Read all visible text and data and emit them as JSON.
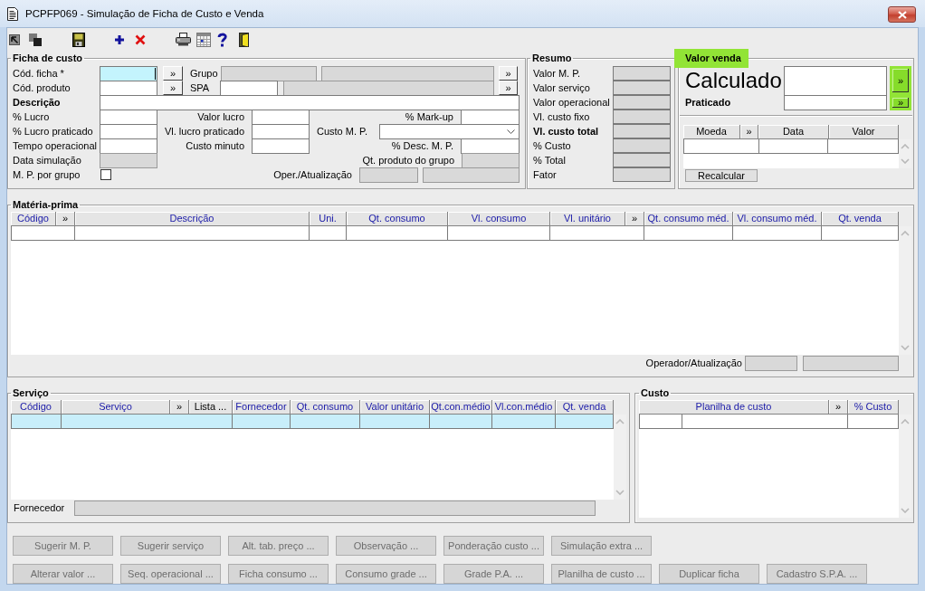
{
  "window": {
    "title": "PCPFP069 - Simulação de Ficha de Custo e Venda"
  },
  "ficha_de_custo": {
    "title": "Ficha de custo",
    "fields": [
      {
        "label": "Cód. ficha *",
        "bold": false,
        "controls": [
          {
            "kind": "field",
            "disabled": false,
            "focused": true
          },
          {
            "kind": "lookup",
            "text": "»"
          }
        ]
      },
      {
        "label": "Grupo",
        "bold": false,
        "controls": [
          {
            "kind": "field",
            "disabled": true,
            "focused": false
          },
          {
            "kind": "field",
            "disabled": true,
            "focused": false
          },
          {
            "kind": "lookup",
            "text": "»"
          }
        ]
      },
      {
        "label": "Cód. produto",
        "bold": false,
        "controls": [
          {
            "kind": "field",
            "disabled": false,
            "focused": false
          },
          {
            "kind": "lookup",
            "text": "»"
          }
        ]
      },
      {
        "label": "SPA",
        "bold": false,
        "controls": [
          {
            "kind": "field",
            "disabled": false,
            "focused": false
          },
          {
            "kind": "field",
            "disabled": true,
            "focused": false
          },
          {
            "kind": "lookup",
            "text": "»"
          }
        ]
      },
      {
        "label": "Descrição",
        "bold": true,
        "controls": [
          {
            "kind": "field",
            "disabled": false,
            "focused": false
          }
        ]
      },
      {
        "label": "% Lucro",
        "bold": false,
        "controls": [
          {
            "kind": "field",
            "disabled": false,
            "focused": false
          }
        ]
      },
      {
        "label": "Valor lucro",
        "bold": false,
        "controls": [
          {
            "kind": "field",
            "disabled": false,
            "focused": false
          }
        ]
      },
      {
        "label": "% Mark-up",
        "bold": false,
        "controls": [
          {
            "kind": "field",
            "disabled": false,
            "focused": false
          }
        ]
      },
      {
        "label": "% Lucro praticado",
        "bold": false,
        "controls": [
          {
            "kind": "field",
            "disabled": false,
            "focused": false
          }
        ]
      },
      {
        "label": "Vl. lucro praticado",
        "bold": false,
        "controls": [
          {
            "kind": "field",
            "disabled": false,
            "focused": false
          }
        ]
      },
      {
        "label": "Custo M. P.",
        "bold": false,
        "controls": [
          {
            "kind": "dropdown"
          }
        ]
      },
      {
        "label": "Tempo operacional",
        "bold": false,
        "controls": [
          {
            "kind": "field",
            "disabled": false,
            "focused": false
          }
        ]
      },
      {
        "label": "Custo minuto",
        "bold": false,
        "controls": [
          {
            "kind": "field",
            "disabled": false,
            "focused": false
          }
        ]
      },
      {
        "label": "% Desc. M. P.",
        "bold": false,
        "controls": [
          {
            "kind": "field",
            "disabled": false,
            "focused": false
          }
        ]
      },
      {
        "label": "Data simulação",
        "bold": false,
        "controls": [
          {
            "kind": "field",
            "disabled": true,
            "focused": false
          }
        ]
      },
      {
        "label": "Qt. produto do grupo",
        "bold": false,
        "controls": [
          {
            "kind": "field",
            "disabled": true,
            "focused": false
          }
        ]
      },
      {
        "label": "M. P. por grupo",
        "bold": false,
        "controls": [
          {
            "kind": "checkbox",
            "checked": false
          }
        ]
      },
      {
        "label": "Oper./Atualização",
        "bold": false,
        "controls": [
          {
            "kind": "field",
            "disabled": true,
            "focused": false
          },
          {
            "kind": "field",
            "disabled": true,
            "focused": false
          }
        ]
      }
    ]
  },
  "resumo": {
    "title": "Resumo",
    "rows": [
      {
        "label": "Valor M. P.",
        "bold": false,
        "disabled": true
      },
      {
        "label": "Valor serviço",
        "bold": false,
        "disabled": true
      },
      {
        "label": "Valor operacional",
        "bold": false,
        "disabled": true
      },
      {
        "label": "Vl. custo fixo",
        "bold": false,
        "disabled": true
      },
      {
        "label": "Vl. custo total",
        "bold": true,
        "disabled": true
      },
      {
        "label": "% Custo",
        "bold": false,
        "disabled": true
      },
      {
        "label": "% Total",
        "bold": false,
        "disabled": true
      },
      {
        "label": "Fator",
        "bold": false,
        "disabled": true
      }
    ]
  },
  "valor_venda": {
    "title": "Valor venda",
    "highlighted": true,
    "fields": [
      {
        "kind": "primary",
        "label": "Calculado",
        "button": {
          "text": "»",
          "highlighted": true
        }
      },
      {
        "kind": "secondary",
        "label": "Praticado",
        "button": {
          "text": "»",
          "highlighted": true
        }
      }
    ],
    "currency_grid": {
      "columns": [
        {
          "label": "Moeda",
          "kind": "plain"
        },
        {
          "label": "»",
          "kind": "plain"
        },
        {
          "label": "Data",
          "kind": "plain"
        },
        {
          "label": "Valor",
          "kind": "plain"
        }
      ],
      "rows": [
        {
          "selected": false
        }
      ]
    },
    "recalculate_button": {
      "label": "Recalcular",
      "disabled": false
    }
  },
  "materia_prima": {
    "title": "Matéria-prima",
    "grid": {
      "columns": [
        {
          "label": "Código",
          "kind": "link"
        },
        {
          "label": "»",
          "kind": "plain"
        },
        {
          "label": "Descrição",
          "kind": "link"
        },
        {
          "label": "Uni.",
          "kind": "link"
        },
        {
          "label": "Qt. consumo",
          "kind": "link"
        },
        {
          "label": "Vl. consumo",
          "kind": "link"
        },
        {
          "label": "Vl. unitário",
          "kind": "link"
        },
        {
          "label": "»",
          "kind": "plain"
        },
        {
          "label": "Qt. consumo méd.",
          "kind": "link"
        },
        {
          "label": "Vl. consumo méd.",
          "kind": "link"
        },
        {
          "label": "Qt. venda",
          "kind": "link"
        }
      ],
      "rows": [
        {
          "selected": false
        }
      ]
    },
    "footer": {
      "label": "Operador/Atualização",
      "fields": [
        {
          "disabled": true
        },
        {
          "disabled": true
        }
      ]
    }
  },
  "servico": {
    "title": "Serviço",
    "grid": {
      "columns": [
        {
          "label": "Código",
          "kind": "link"
        },
        {
          "label": "Serviço",
          "kind": "link"
        },
        {
          "label": "»",
          "kind": "plain"
        },
        {
          "label": "Lista ...",
          "kind": "plain"
        },
        {
          "label": "Fornecedor",
          "kind": "link"
        },
        {
          "label": "Qt. consumo",
          "kind": "link"
        },
        {
          "label": "Valor unitário",
          "kind": "link"
        },
        {
          "label": "Qt.con.médio",
          "kind": "link"
        },
        {
          "label": "Vl.con.médio",
          "kind": "link"
        },
        {
          "label": "Qt. venda",
          "kind": "link"
        }
      ],
      "rows": [
        {
          "selected": true
        }
      ]
    },
    "footer": {
      "label": "Fornecedor",
      "fields": [
        {
          "disabled": true
        }
      ]
    }
  },
  "custo": {
    "title": "Custo",
    "grid": {
      "columns": [
        {
          "label": "Planilha de custo",
          "kind": "link"
        },
        {
          "label": "»",
          "kind": "plain"
        },
        {
          "label": "% Custo",
          "kind": "link"
        }
      ],
      "rows": [
        {
          "selected": false
        }
      ]
    }
  },
  "action_buttons": [
    [
      {
        "label": "Sugerir M. P.",
        "disabled": true
      },
      {
        "label": "Sugerir serviço",
        "disabled": true
      },
      {
        "label": "Alt. tab. preço ...",
        "disabled": true
      },
      {
        "label": "Observação ...",
        "disabled": true
      },
      {
        "label": "Ponderação custo ...",
        "disabled": true
      },
      {
        "label": "Simulação extra ...",
        "disabled": true
      }
    ],
    [
      {
        "label": "Alterar valor ...",
        "disabled": true
      },
      {
        "label": "Seq. operacional ...",
        "disabled": true
      },
      {
        "label": "Ficha consumo ...",
        "disabled": true
      },
      {
        "label": "Consumo grade ...",
        "disabled": true
      },
      {
        "label": "Grade P.A. ...",
        "disabled": true
      },
      {
        "label": "Planilha de custo ...",
        "disabled": true
      },
      {
        "label": "Duplicar ficha",
        "disabled": true
      },
      {
        "label": "Cadastro S.P.A. ...",
        "disabled": true
      }
    ]
  ]
}
